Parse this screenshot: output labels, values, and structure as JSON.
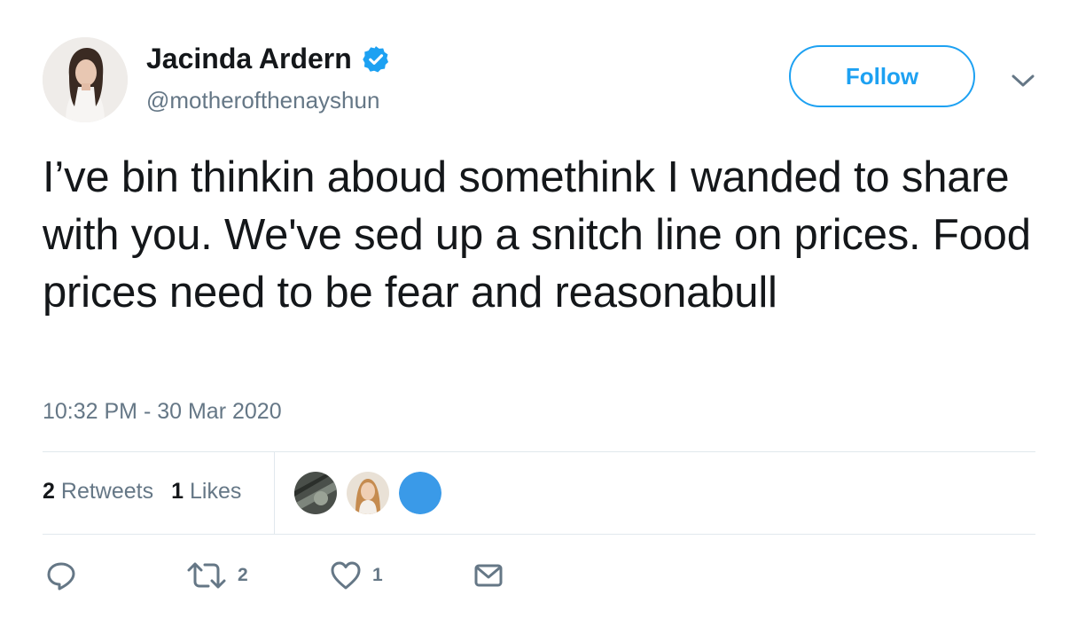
{
  "author": {
    "display_name": "Jacinda Ardern",
    "handle": "@motherofthenayshun",
    "verified_icon": "verified-badge-icon"
  },
  "follow_label": "Follow",
  "tweet": {
    "text": "I’ve bin thinkin aboud somethink I wanded to share with you. We've sed up a snitch line on prices. Food prices need to be fear and reasonabull",
    "timestamp": "10:32 PM - 30 Mar 2020"
  },
  "stats": {
    "retweets_count": "2",
    "retweets_label": "Retweets",
    "likes_count": "1",
    "likes_label": "Likes"
  },
  "actions": {
    "reply_icon": "reply-icon",
    "retweet_icon": "retweet-icon",
    "retweet_count": "2",
    "like_icon": "heart-icon",
    "like_count": "1",
    "dm_icon": "envelope-icon"
  },
  "colors": {
    "accent": "#1da1f2",
    "text": "#14171a",
    "secondary": "#657786",
    "border": "#e1e8ed"
  }
}
